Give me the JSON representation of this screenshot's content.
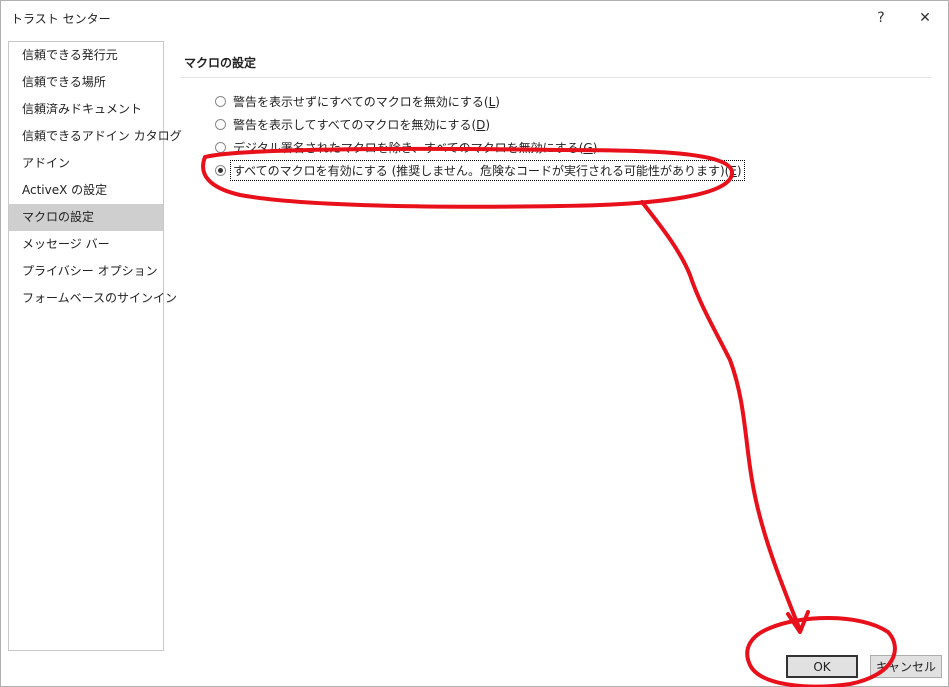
{
  "window": {
    "title": "トラスト センター",
    "help_glyph": "?",
    "close_glyph": "✕"
  },
  "sidebar": {
    "items": [
      {
        "label": "信頼できる発行元",
        "selected": false
      },
      {
        "label": "信頼できる場所",
        "selected": false
      },
      {
        "label": "信頼済みドキュメント",
        "selected": false
      },
      {
        "label": "信頼できるアドイン カタログ",
        "selected": false
      },
      {
        "label": "アドイン",
        "selected": false
      },
      {
        "label": "ActiveX の設定",
        "selected": false
      },
      {
        "label": "マクロの設定",
        "selected": true
      },
      {
        "label": "メッセージ バー",
        "selected": false
      },
      {
        "label": "プライバシー オプション",
        "selected": false
      },
      {
        "label": "フォームベースのサインイン",
        "selected": false
      }
    ]
  },
  "macro_settings": {
    "heading": "マクロの設定",
    "options": [
      {
        "text": "警告を表示せずにすべてのマクロを無効にする(",
        "key": "L",
        "tail": ")",
        "checked": false
      },
      {
        "text": "警告を表示してすべてのマクロを無効にする(",
        "key": "D",
        "tail": ")",
        "checked": false
      },
      {
        "text": "デジタル署名されたマクロを除き、すべてのマクロを無効にする(",
        "key": "G",
        "tail": ")",
        "checked": false
      },
      {
        "text": "すべてのマクロを有効にする (推奨しません。危険なコードが実行される可能性があります)(",
        "key": "E",
        "tail": ")",
        "checked": true
      }
    ]
  },
  "buttons": {
    "ok": "OK",
    "cancel": "キャンセル"
  },
  "colors": {
    "annotation": "#e8101a",
    "selected_nav_bg": "#cfcfcf"
  },
  "icons": {
    "help": "help-icon",
    "close": "close-icon"
  }
}
